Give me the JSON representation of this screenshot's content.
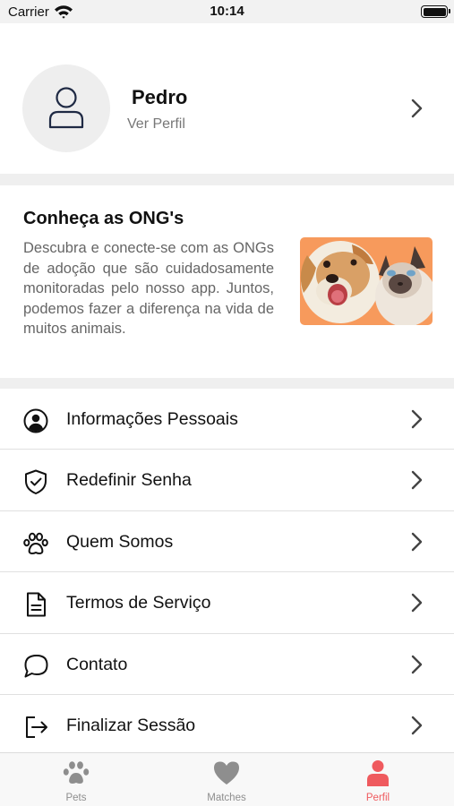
{
  "status_bar": {
    "carrier": "Carrier",
    "time": "10:14",
    "icons": [
      "wifi-icon",
      "battery-icon"
    ]
  },
  "profile": {
    "name": "Pedro",
    "link": "Ver Perfil",
    "avatar_icon": "user-icon"
  },
  "ong_card": {
    "title": "Conheça as ONG's",
    "description": "Descubra e conecte-se com as ONGs de adoção que são cuidadosamente monitoradas pelo nosso app. Juntos, podemos fazer a diferença na vida de muitos animais.",
    "image": "dog-and-cat-photo"
  },
  "menu": {
    "items": [
      {
        "label": "Informações Pessoais",
        "icon": "user-circle-icon"
      },
      {
        "label": "Redefinir Senha",
        "icon": "shield-check-icon"
      },
      {
        "label": "Quem Somos",
        "icon": "paw-icon"
      },
      {
        "label": "Termos de Serviço",
        "icon": "document-icon"
      },
      {
        "label": "Contato",
        "icon": "chat-icon"
      },
      {
        "label": "Finalizar Sessão",
        "icon": "logout-icon"
      }
    ]
  },
  "tabbar": {
    "tabs": [
      {
        "label": "Pets",
        "icon": "paw-icon",
        "active": false
      },
      {
        "label": "Matches",
        "icon": "heart-icon",
        "active": false
      },
      {
        "label": "Perfil",
        "icon": "person-icon",
        "active": true
      }
    ]
  },
  "colors": {
    "accent": "#ef5a5e",
    "inactive_tab": "#8e8e8e",
    "separator_gap": "#efefef",
    "avatar_bg": "#eeeeee",
    "photo_bg": "#f79a5c"
  }
}
